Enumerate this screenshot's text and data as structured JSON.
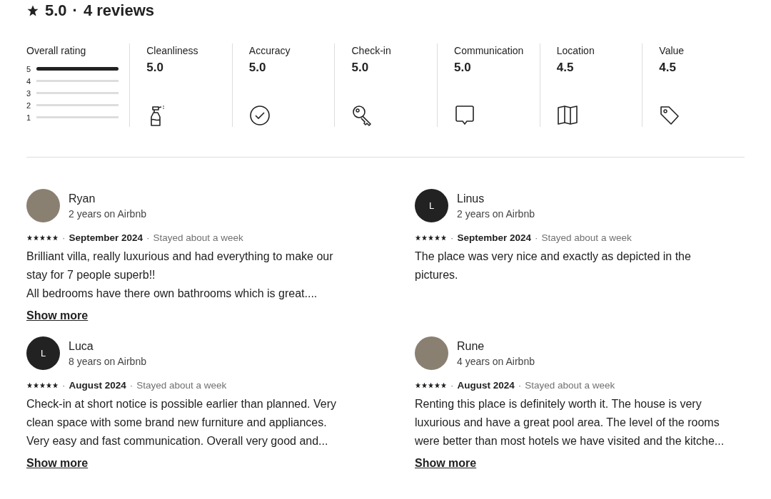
{
  "header": {
    "rating": "5.0",
    "separator": "·",
    "count": "4 reviews"
  },
  "overall": {
    "label": "Overall rating",
    "bars": [
      {
        "label": "5",
        "level": 1
      },
      {
        "label": "4",
        "level": 0
      },
      {
        "label": "3",
        "level": 0
      },
      {
        "label": "2",
        "level": 0
      },
      {
        "label": "1",
        "level": 0
      }
    ]
  },
  "categories": [
    {
      "label": "Cleanliness",
      "score": "5.0",
      "kind": "spray"
    },
    {
      "label": "Accuracy",
      "score": "5.0",
      "kind": "check"
    },
    {
      "label": "Check-in",
      "score": "5.0",
      "kind": "key"
    },
    {
      "label": "Communication",
      "score": "5.0",
      "kind": "chat"
    },
    {
      "label": "Location",
      "score": "4.5",
      "kind": "map"
    },
    {
      "label": "Value",
      "score": "4.5",
      "kind": "tag"
    }
  ],
  "reviews": [
    {
      "name": "Ryan",
      "tenure": "2 years on Airbnb",
      "avatar": {
        "kind": "photo"
      },
      "stars": 5,
      "separator": "·",
      "date": "September 2024",
      "stay": "Stayed about a week",
      "text": "Brilliant villa, really luxurious and had everything to make our stay for 7 people superb!!\nAll bedrooms have there own bathrooms which is great....",
      "link": "Show more"
    },
    {
      "name": "Linus",
      "tenure": "2 years on Airbnb",
      "avatar": {
        "kind": "initial",
        "initial": "L"
      },
      "stars": 5,
      "separator": "·",
      "date": "September 2024",
      "stay": "Stayed about a week",
      "text": "The place was very nice and exactly as depicted in the pictures."
    },
    {
      "name": "Luca",
      "tenure": "8 years on Airbnb",
      "avatar": {
        "kind": "initial",
        "initial": "L"
      },
      "stars": 5,
      "separator": "·",
      "date": "August 2024",
      "stay": "Stayed about a week",
      "text": "Check-in at short notice is possible earlier than planned. Very clean space with some brand new furniture and appliances. Very easy and fast communication. Overall very good and...",
      "link": "Show more"
    },
    {
      "name": "Rune",
      "tenure": "4 years on Airbnb",
      "avatar": {
        "kind": "photo"
      },
      "stars": 5,
      "separator": "·",
      "date": "August 2024",
      "stay": "Stayed about a week",
      "text": "Renting this place is definitely worth it. The house is very luxurious and have a great pool area. The level of the rooms were better than most hotels we have visited and the kitche...",
      "link": "Show more"
    }
  ]
}
